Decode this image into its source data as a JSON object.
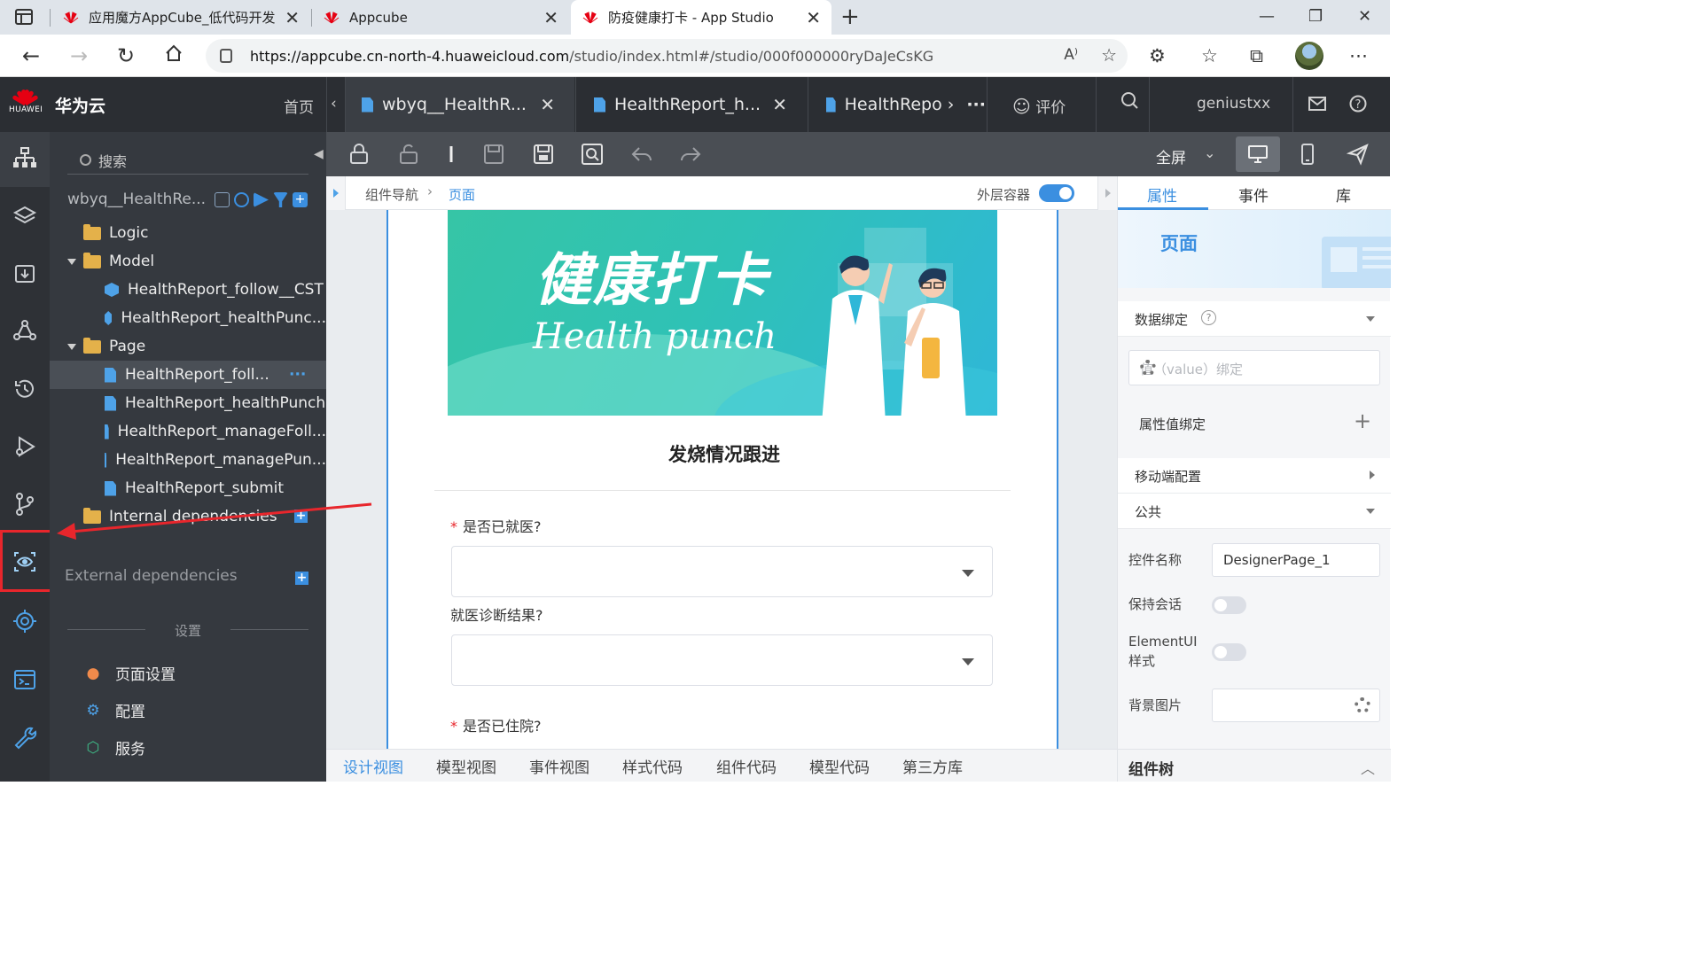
{
  "browser": {
    "tabs": [
      {
        "title": "应用魔方AppCube_低代码开发平",
        "active": false
      },
      {
        "title": "Appcube",
        "active": false
      },
      {
        "title": "防疫健康打卡 - App Studio",
        "active": true
      }
    ],
    "url_host": "https://appcube.cn-north-4.huaweicloud.com",
    "url_path": "/studio/index.html#/studio/000f000000ryDaJeCsKG"
  },
  "header": {
    "brand_small": "HUAWEI",
    "brand": "华为云",
    "home": "首页",
    "editor_tabs": [
      {
        "label": "wbyq__HealthR...",
        "active": true
      },
      {
        "label": "HealthReport_h...",
        "active": false
      },
      {
        "label": "HealthRepo",
        "active": false
      }
    ],
    "rate": "评价",
    "user": "geniustxx"
  },
  "explorer": {
    "search_placeholder": "搜索",
    "project": "wbyq__HealthRe...",
    "items": [
      {
        "label": "Logic",
        "type": "folder"
      },
      {
        "label": "Model",
        "type": "folder"
      },
      {
        "label": "HealthReport_follow__CST",
        "type": "object"
      },
      {
        "label": "HealthReport_healthPunc...",
        "type": "object"
      },
      {
        "label": "Page",
        "type": "folder"
      },
      {
        "label": "HealthReport_foll...",
        "type": "page"
      },
      {
        "label": "HealthReport_healthPunch",
        "type": "page"
      },
      {
        "label": "HealthReport_manageFoll...",
        "type": "page"
      },
      {
        "label": "HealthReport_managePun...",
        "type": "page"
      },
      {
        "label": "HealthReport_submit",
        "type": "page"
      },
      {
        "label": "Internal dependencies",
        "type": "folder"
      }
    ],
    "more": "···",
    "external": "External dependencies",
    "settings_header": "设置",
    "settings": [
      {
        "label": "页面设置",
        "icon": "location-pin-icon",
        "color": "#f08a4b"
      },
      {
        "label": "配置",
        "icon": "gear-icon",
        "color": "#4ea2e8"
      },
      {
        "label": "服务",
        "icon": "service-icon",
        "color": "#3fc08a"
      }
    ]
  },
  "toolbar": {
    "fullscreen": "全屏"
  },
  "canvas": {
    "breadcrumb_root": "组件导航",
    "breadcrumb_current": "页面",
    "outer_container": "外层容器",
    "banner_title": "健康打卡",
    "banner_subtitle": "Health punch",
    "form_title": "发烧情况跟进",
    "questions": [
      {
        "label": "是否已就医?",
        "required": true
      },
      {
        "label": "就医诊断结果?",
        "required": false
      },
      {
        "label": "是否已住院?",
        "required": true
      }
    ]
  },
  "bottom_tabs": [
    "设计视图",
    "模型视图",
    "事件视图",
    "样式代码",
    "组件代码",
    "模型代码",
    "第三方库"
  ],
  "right_panel": {
    "tabs": [
      "属性",
      "事件",
      "库"
    ],
    "hero": "页面",
    "data_binding": "数据绑定",
    "value_binding_placeholder": "值（value）绑定",
    "attr_binding": "属性值绑定",
    "mobile_config": "移动端配置",
    "public": "公共",
    "control_name_label": "控件名称",
    "control_name_value": "DesignerPage_1",
    "keep_session": "保持会话",
    "elementui_style": "ElementUI样式",
    "bg_image": "背景图片",
    "component_tree": "组件树"
  },
  "colors": {
    "accent": "#3b8fe0",
    "annotation_red": "#e8262c",
    "huawei_red": "#e60012"
  }
}
